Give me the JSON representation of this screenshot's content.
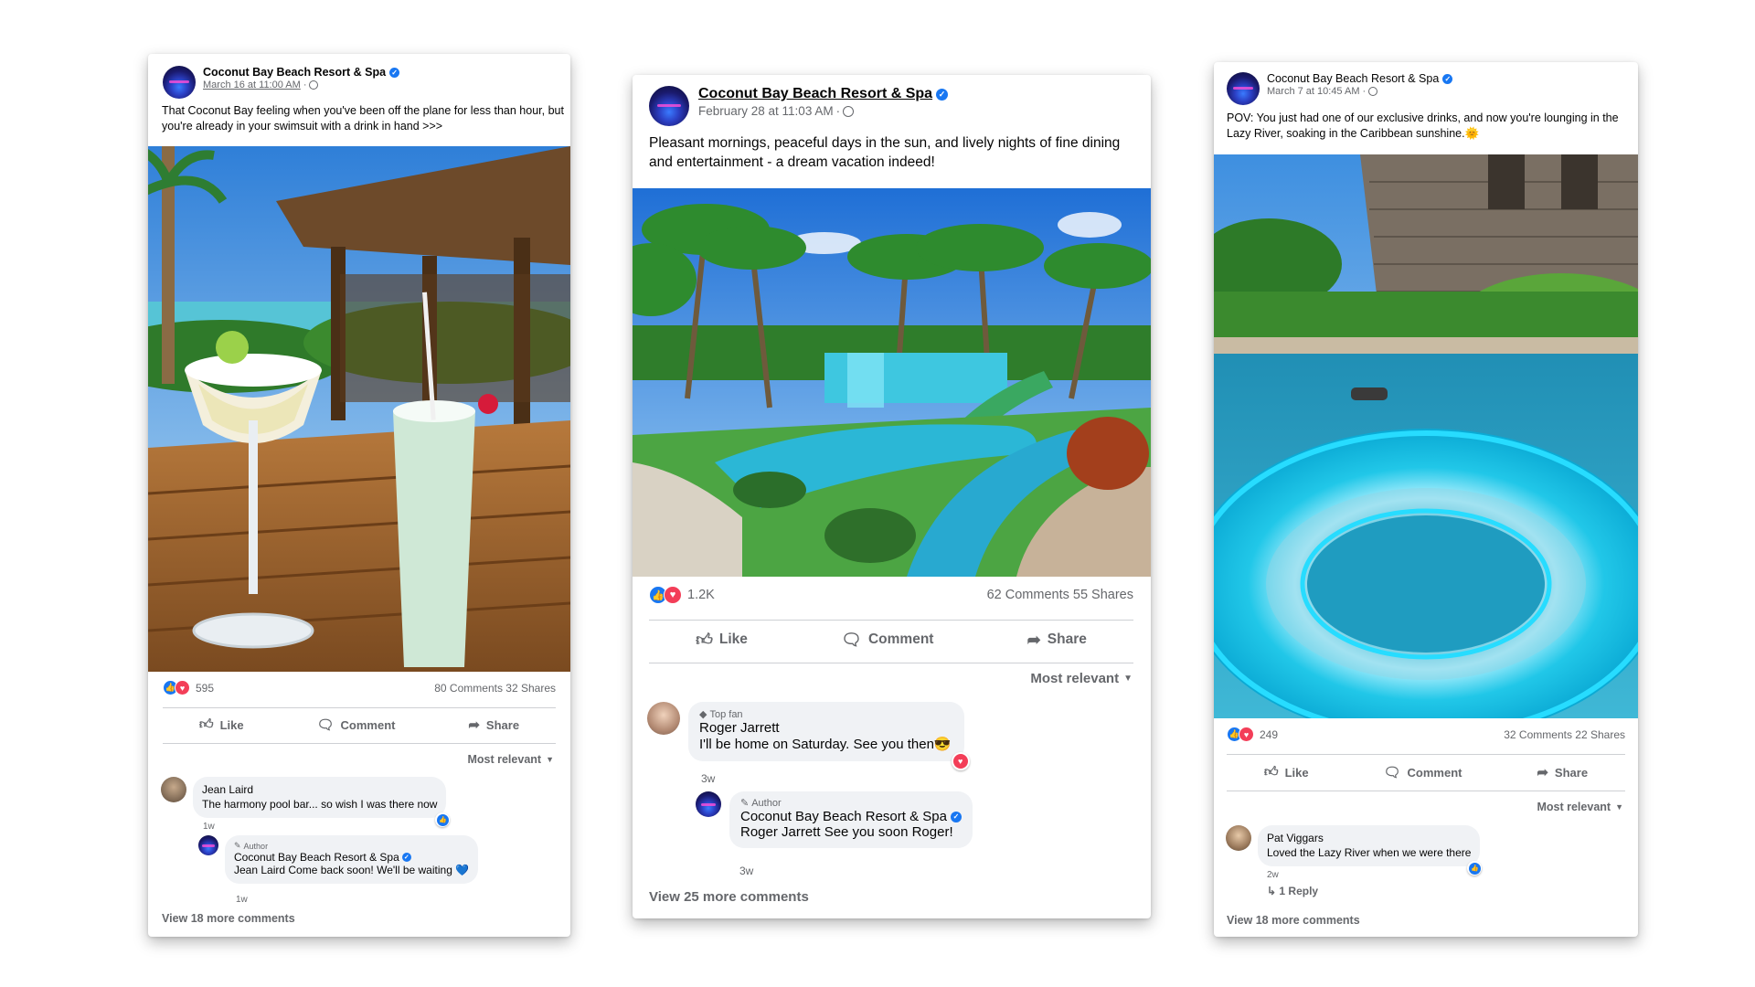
{
  "posts": [
    {
      "page_name": "Coconut Bay Beach Resort & Spa",
      "date": "March 16 at 11:00 AM",
      "caption": "That Coconut Bay feeling when you've been off the plane for less than hour, but you're already in your swimsuit with a drink in hand >>>",
      "reactions": "595",
      "comments_count": "80 Comments",
      "shares_count": "32 Shares",
      "like_label": "Like",
      "comment_label": "Comment",
      "share_label": "Share",
      "sort_label": "Most relevant",
      "comments": [
        {
          "name": "Jean Laird",
          "text": "The harmony pool bar... so wish I was there now",
          "time": "1w"
        },
        {
          "badge": "Author",
          "name": "Coconut Bay Beach Resort & Spa",
          "text": "Jean Laird Come back soon! We'll be waiting 💙",
          "time": "1w"
        }
      ],
      "view_more": "View 18 more comments"
    },
    {
      "page_name": "Coconut Bay Beach Resort & Spa",
      "date": "February 28 at 11:03 AM",
      "caption": "Pleasant mornings, peaceful days in the sun, and lively nights of fine dining and entertainment - a dream vacation indeed!",
      "reactions": "1.2K",
      "comments_count": "62 Comments",
      "shares_count": "55 Shares",
      "like_label": "Like",
      "comment_label": "Comment",
      "share_label": "Share",
      "sort_label": "Most relevant",
      "comments": [
        {
          "badge": "Top fan",
          "name": "Roger Jarrett",
          "text": "I'll be home on Saturday. See you then😎",
          "time": "3w"
        },
        {
          "badge": "Author",
          "name": "Coconut Bay Beach Resort & Spa",
          "text": "Roger Jarrett See you soon Roger!",
          "time": "3w"
        }
      ],
      "view_more": "View 25 more comments"
    },
    {
      "page_name": "Coconut Bay Beach Resort & Spa",
      "date": "March 7 at 10:45 AM",
      "caption": "POV: You just had one of our exclusive drinks, and now you're lounging in the Lazy River, soaking in the Caribbean sunshine.🌞",
      "reactions": "249",
      "comments_count": "32 Comments",
      "shares_count": "22 Shares",
      "like_label": "Like",
      "comment_label": "Comment",
      "share_label": "Share",
      "sort_label": "Most relevant",
      "comments": [
        {
          "name": "Pat Viggars",
          "text": "Loved the Lazy River when we were there",
          "time": "2w",
          "reply": "1 Reply"
        }
      ],
      "view_more": "View 18 more comments"
    }
  ],
  "colors": {
    "facebook_blue": "#1877f2",
    "love_red": "#f33e58",
    "secondary_text": "#65676b",
    "bubble": "#f0f2f5"
  }
}
